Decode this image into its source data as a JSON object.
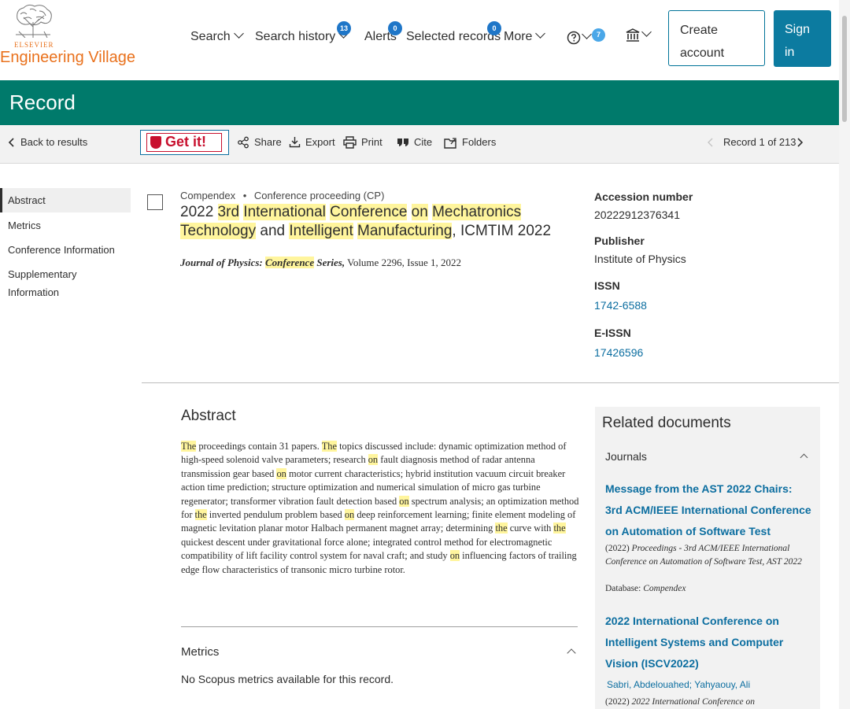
{
  "header": {
    "brand_publisher": "ELSEVIER",
    "brand_name": "Engineering Village",
    "nav": {
      "search": "Search",
      "search_history": "Search history",
      "search_history_count": "13",
      "alerts": "Alerts",
      "alerts_count": "0",
      "selected_records": "Selected records",
      "selected_records_count": "0",
      "more": "More",
      "help_count": "7"
    },
    "create_account": "Create account",
    "sign_in": "Sign in"
  },
  "page_title": "Record",
  "toolbar": {
    "back": "Back to results",
    "get_it": "Get it!",
    "share": "Share",
    "export": "Export",
    "print": "Print",
    "cite": "Cite",
    "folders": "Folders",
    "record_position": "Record 1 of 213"
  },
  "left_nav": [
    "Abstract",
    "Metrics",
    "Conference Information",
    "Supplementary Information"
  ],
  "record": {
    "database": "Compendex",
    "doc_type": "Conference proceeding (CP)",
    "title_parts": [
      {
        "t": "2022 ",
        "hl": false
      },
      {
        "t": "3rd",
        "hl": true
      },
      {
        "t": " ",
        "hl": false
      },
      {
        "t": "International",
        "hl": true
      },
      {
        "t": " ",
        "hl": false
      },
      {
        "t": "Conference",
        "hl": true
      },
      {
        "t": " ",
        "hl": false
      },
      {
        "t": "on",
        "hl": true
      },
      {
        "t": " ",
        "hl": false
      },
      {
        "t": "Mechatronics",
        "hl": true
      },
      {
        "t": " ",
        "hl": false
      },
      {
        "t": "Technology",
        "hl": true
      },
      {
        "t": " and ",
        "hl": false
      },
      {
        "t": "Intelligent",
        "hl": true
      },
      {
        "t": " ",
        "hl": false
      },
      {
        "t": "Manufacturing",
        "hl": true
      },
      {
        "t": ", ICMTIM 2022",
        "hl": false
      }
    ],
    "journal_prefix": "Journal of Physics: ",
    "journal_hl": "Conference",
    "journal_suffix": " Series,",
    "volume_issue": " Volume 2296, Issue 1, 2022"
  },
  "details": {
    "accession_label": "Accession number",
    "accession_value": "20222912376341",
    "publisher_label": "Publisher",
    "publisher_value": "Institute of Physics",
    "issn_label": "ISSN",
    "issn_value": "1742-6588",
    "eissn_label": "E-ISSN",
    "eissn_value": "17426596"
  },
  "abstract": {
    "heading": "Abstract",
    "parts": [
      {
        "t": "The",
        "hl": true
      },
      {
        "t": " proceedings contain 31 papers. ",
        "hl": false
      },
      {
        "t": "The",
        "hl": true
      },
      {
        "t": " topics discussed include: dynamic optimization method of high-speed solenoid valve parameters; research ",
        "hl": false
      },
      {
        "t": "on",
        "hl": true
      },
      {
        "t": " fault diagnosis method of radar antenna transmission gear based ",
        "hl": false
      },
      {
        "t": "on",
        "hl": true
      },
      {
        "t": " motor current characteristics; hybrid institution vacuum circuit breaker action time prediction; structure optimization and numerical simulation of micro gas turbine regenerator; transformer vibration fault detection based ",
        "hl": false
      },
      {
        "t": "on",
        "hl": true
      },
      {
        "t": " spectrum analysis; an optimization method for ",
        "hl": false
      },
      {
        "t": "the",
        "hl": true
      },
      {
        "t": " inverted pendulum problem based ",
        "hl": false
      },
      {
        "t": "on",
        "hl": true
      },
      {
        "t": " deep reinforcement learning; finite element modeling of magnetic levitation planar motor Halbach permanent magnet array; determining ",
        "hl": false
      },
      {
        "t": "the",
        "hl": true
      },
      {
        "t": " curve with ",
        "hl": false
      },
      {
        "t": "the",
        "hl": true
      },
      {
        "t": " quickest descent under gravitational force alone; integrated control method for electromagnetic compatibility of lift facility control system for naval craft; and study ",
        "hl": false
      },
      {
        "t": "on",
        "hl": true
      },
      {
        "t": " influencing factors of trailing edge flow characteristics of transonic micro turbine rotor.",
        "hl": false
      }
    ]
  },
  "metrics": {
    "heading": "Metrics",
    "text": "No Scopus metrics available for this record."
  },
  "related": {
    "heading": "Related documents",
    "section": "Journals",
    "items": [
      {
        "title": "Message from the AST 2022 Chairs: 3rd ACM/IEEE International Conference on Automation of Software Test",
        "source_prefix": "(2022) ",
        "source": "Proceedings - 3rd ACM/IEEE International Conference on Automation of Software Test, AST 2022",
        "db_label": "Database: ",
        "db": "Compendex"
      },
      {
        "title": "2022 International Conference on Intelligent Systems and Computer Vision (ISCV2022)",
        "authors": "Sabri, Abdelouahed; Yahyaouy, Ali",
        "source_prefix": "(2022) ",
        "source": "2022 International Conference on"
      }
    ]
  }
}
